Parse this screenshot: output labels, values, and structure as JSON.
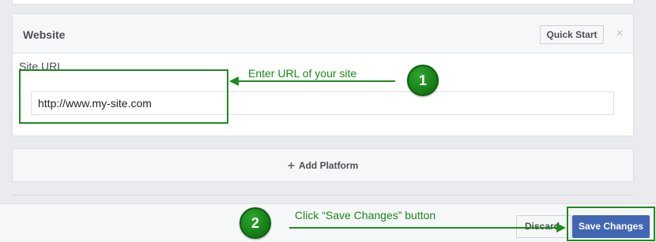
{
  "website_panel": {
    "title": "Website",
    "quick_start_label": "Quick Start",
    "close_glyph": "×",
    "site_url_label": "Site URL",
    "site_url_value": "http://www.my-site.com"
  },
  "add_platform": {
    "plus_glyph": "+",
    "label": "Add Platform"
  },
  "footer": {
    "discard_label": "Discard",
    "save_label": "Save Changes"
  },
  "annotations": {
    "step1_number": "1",
    "step1_text": "Enter URL of your site",
    "step2_number": "2",
    "step2_text": "Click “Save Changes” button",
    "highlight_color": "#1f8a1f"
  },
  "colors": {
    "primary_button": "#4267b2",
    "page_background": "#e9ebee"
  }
}
